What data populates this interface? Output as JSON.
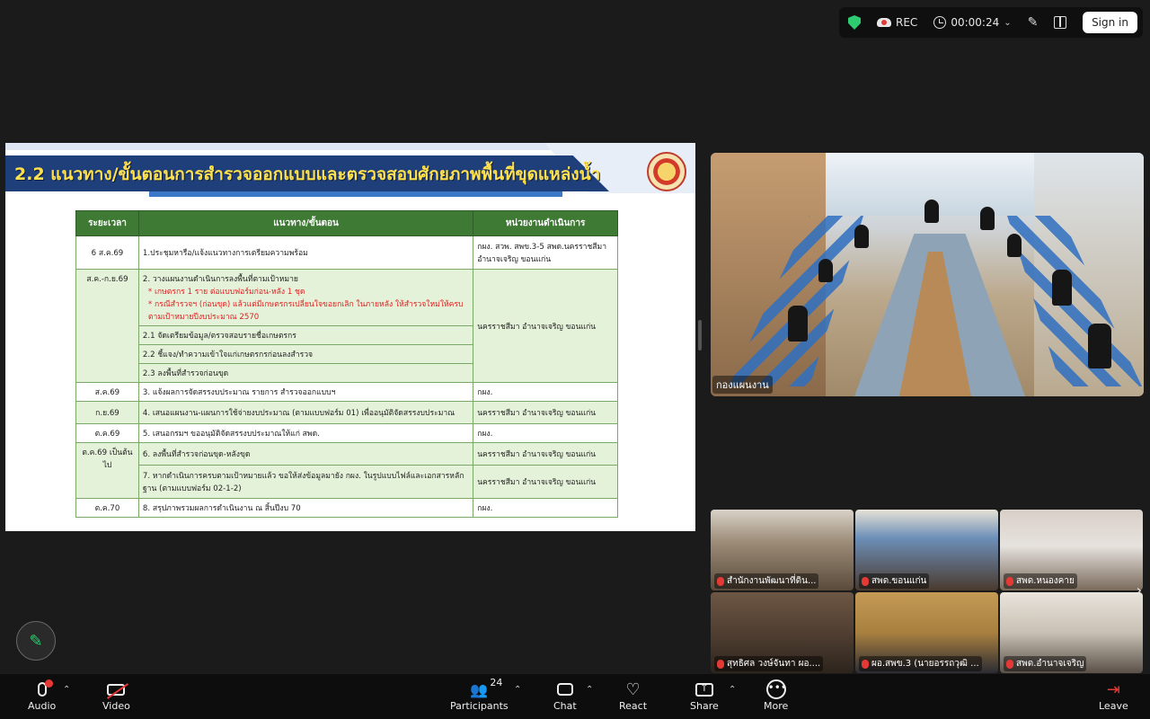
{
  "topbar": {
    "rec_label": "REC",
    "timer": "00:00:24",
    "signin_label": "Sign in"
  },
  "slide": {
    "title": "2.2 แนวทาง/ขั้นตอนการสำรวจออกแบบและตรวจสอบศักยภาพพื้นที่ขุดแหล่งน้ำ",
    "headers": [
      "ระยะเวลา",
      "แนวทาง/ขั้นตอน",
      "หน่วยงานดำเนินการ"
    ],
    "rows": {
      "r1": {
        "time": "6 ส.ค.69",
        "step": "1.ประชุมหารือ/แจ้งแนวทางการเตรียมความพร้อม",
        "unit": "กผง. สวพ. สพข.3-5 สพด.นครราชสีมา อำนาจเจริญ ขอนแก่น"
      },
      "r2": {
        "time": "ส.ค.-ก.ย.69",
        "step": "2. วางแผนงานดำเนินการลงพื้นที่ตามเป้าหมาย",
        "note1": "* เกษตรกร 1 ราย ต่อแบบฟอร์มก่อน-หลัง 1 ชุด",
        "note2": "* กรณีสำรวจฯ (ก่อนขุด) แล้วแต่มีเกษตรกรเปลี่ยนใจขอยกเลิก ในภายหลัง ให้สำรวจใหม่ให้ครบตามเป้าหมายปีงบประมาณ 2570",
        "sub1": "2.1 จัดเตรียมข้อมูล/ตรวจสอบรายชื่อเกษตรกร",
        "sub2": "2.2 ชี้แจง/ทำความเข้าใจแก่เกษตรกรก่อนลงสำรวจ",
        "sub3": "2.3 ลงพื้นที่สำรวจก่อนขุด",
        "unit": "นครราชสีมา อำนาจเจริญ ขอนแก่น"
      },
      "r3": {
        "time": "ส.ค.69",
        "step": "3. แจ้งผลการจัดสรรงบประมาณ รายการ สำรวจออกแบบฯ",
        "unit": "กผง."
      },
      "r4": {
        "time": "ก.ย.69",
        "step": "4. เสนอแผนงาน-แผนการใช้จ่ายงบประมาณ (ตามแบบฟอร์ม 01) เพื่ออนุมัติจัดสรรงบประมาณ",
        "unit": "นครราชสีมา อำนาจเจริญ ขอนแก่น"
      },
      "r5": {
        "time": "ต.ค.69",
        "step": "5. เสนอกรมฯ ขออนุมัติจัดสรรงบประมาณให้แก่ สพด.",
        "unit": "กผง."
      },
      "r6": {
        "time": "ต.ค.69 เป็นต้นไป",
        "step": "6. ลงพื้นที่สำรวจก่อนขุด-หลังขุด",
        "unit": "นครราชสีมา อำนาจเจริญ ขอนแก่น"
      },
      "r7": {
        "step": "7. หากดำเนินการครบตามเป้าหมายแล้ว ขอให้ส่งข้อมูลมายัง กผง. ในรูปแบบไฟล์และเอกสารหลักฐาน (ตามแบบฟอร์ม 02-1-2)",
        "unit": "นครราชสีมา อำนาจเจริญ ขอนแก่น"
      },
      "r8": {
        "time": "ต.ค.70",
        "step": "8. สรุปภาพรวมผลการดำเนินงาน ณ สิ้นปีงบ 70",
        "unit": "กผง."
      }
    }
  },
  "main_video": {
    "name": "กองแผนงาน"
  },
  "thumbnails": [
    {
      "name": "สำนักงานพัฒนาที่ดิน..."
    },
    {
      "name": "สพด.ขอนแก่น"
    },
    {
      "name": "สพด.หนองคาย"
    },
    {
      "name": "สุทธิศล วงษ์จันทา ผอ...."
    },
    {
      "name": "ผอ.สพข.3 (นายอรรถวุฒิ ..."
    },
    {
      "name": "สพด.อำนาจเจริญ"
    }
  ],
  "bottombar": {
    "audio": "Audio",
    "video": "Video",
    "participants": "Participants",
    "participant_count": "24",
    "chat": "Chat",
    "react": "React",
    "share": "Share",
    "more": "More",
    "leave": "Leave"
  },
  "colors": {
    "slide_band": "#1f3f7a",
    "title_text": "#ffe14d",
    "table_header": "#3f7a35",
    "table_fill": "#e5f2da",
    "alert": "#e53935",
    "secure": "#2ecc71"
  },
  "icons": [
    "shield-icon",
    "record-icon",
    "clock-icon",
    "magic-wand-icon",
    "layout-icon",
    "pencil-icon",
    "microphone-icon",
    "video-camera-icon",
    "participants-icon",
    "chat-icon",
    "heart-icon",
    "share-screen-icon",
    "more-icon",
    "leave-icon",
    "chevron-up-icon",
    "chevron-right-icon"
  ]
}
